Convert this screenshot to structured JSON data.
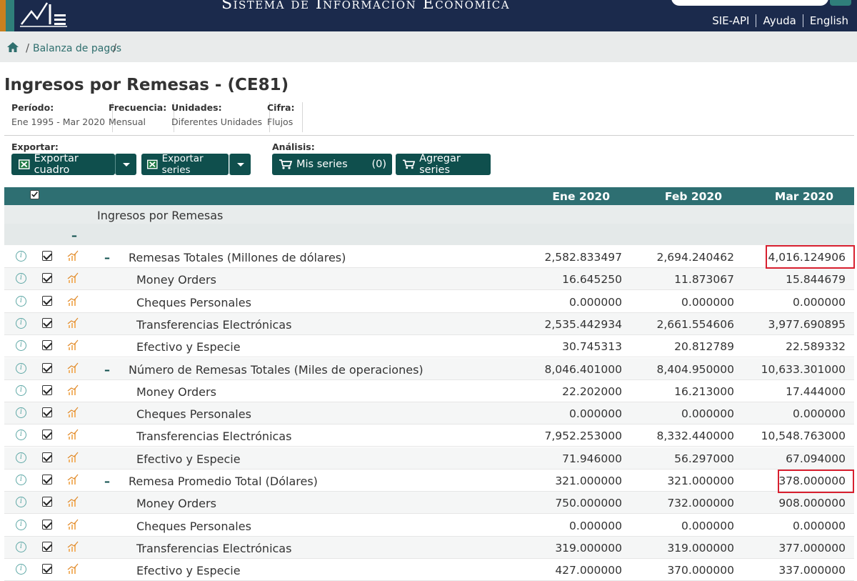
{
  "header": {
    "site_title": "Sistema de Información Económica",
    "links": [
      "SIE-API",
      "Ayuda",
      "English"
    ]
  },
  "breadcrumb": {
    "items": [
      "Balanza de pagos"
    ]
  },
  "page": {
    "title": "Ingresos por Remesas - (CE81)",
    "meta": [
      {
        "label": "Período:",
        "value": "Ene 1995 - Mar 2020"
      },
      {
        "label": "Frecuencia:",
        "value": "Mensual"
      },
      {
        "label": "Unidades:",
        "value": "Diferentes Unidades"
      },
      {
        "label": "Cifra:",
        "value": "Flujos"
      }
    ]
  },
  "toolbar": {
    "export_label": "Exportar:",
    "export_table": "Exportar cuadro",
    "export_series": "Exportar series",
    "analysis_label": "Análisis:",
    "my_series": "Mis series",
    "my_series_count": "(0)",
    "add_series": "Agregar series"
  },
  "table": {
    "columns": [
      "Ene 2020",
      "Feb 2020",
      "Mar 2020"
    ],
    "group_title": "Ingresos por Remesas",
    "rows": [
      {
        "name": "Remesas Totales (Millones de dólares)",
        "level": 1,
        "values": [
          "2,582.833497",
          "2,694.240462",
          "4,016.124906"
        ],
        "highlight": true
      },
      {
        "name": "Money Orders",
        "level": 2,
        "values": [
          "16.645250",
          "11.873067",
          "15.844679"
        ]
      },
      {
        "name": "Cheques Personales",
        "level": 2,
        "values": [
          "0.000000",
          "0.000000",
          "0.000000"
        ]
      },
      {
        "name": "Transferencias Electrónicas",
        "level": 2,
        "values": [
          "2,535.442934",
          "2,661.554606",
          "3,977.690895"
        ]
      },
      {
        "name": "Efectivo y Especie",
        "level": 2,
        "values": [
          "30.745313",
          "20.812789",
          "22.589332"
        ]
      },
      {
        "name": "Número de Remesas Totales (Miles de operaciones)",
        "level": 1,
        "values": [
          "8,046.401000",
          "8,404.950000",
          "10,633.301000"
        ]
      },
      {
        "name": "Money Orders",
        "level": 2,
        "values": [
          "22.202000",
          "16.213000",
          "17.444000"
        ]
      },
      {
        "name": "Cheques Personales",
        "level": 2,
        "values": [
          "0.000000",
          "0.000000",
          "0.000000"
        ]
      },
      {
        "name": "Transferencias Electrónicas",
        "level": 2,
        "values": [
          "7,952.253000",
          "8,332.440000",
          "10,548.763000"
        ]
      },
      {
        "name": "Efectivo y Especie",
        "level": 2,
        "values": [
          "71.946000",
          "56.297000",
          "67.094000"
        ]
      },
      {
        "name": "Remesa Promedio Total (Dólares)",
        "level": 1,
        "values": [
          "321.000000",
          "321.000000",
          "378.000000"
        ],
        "highlight": true
      },
      {
        "name": "Money Orders",
        "level": 2,
        "values": [
          "750.000000",
          "732.000000",
          "908.000000"
        ]
      },
      {
        "name": "Cheques Personales",
        "level": 2,
        "values": [
          "0.000000",
          "0.000000",
          "0.000000"
        ]
      },
      {
        "name": "Transferencias Electrónicas",
        "level": 2,
        "values": [
          "319.000000",
          "319.000000",
          "377.000000"
        ]
      },
      {
        "name": "Efectivo y Especie",
        "level": 2,
        "values": [
          "427.000000",
          "370.000000",
          "337.000000"
        ]
      }
    ]
  },
  "colors": {
    "header_bg": "#1b2a4c",
    "accent": "#0f4f4d",
    "table_header": "#2e6f72",
    "highlight": "#d8202f"
  }
}
